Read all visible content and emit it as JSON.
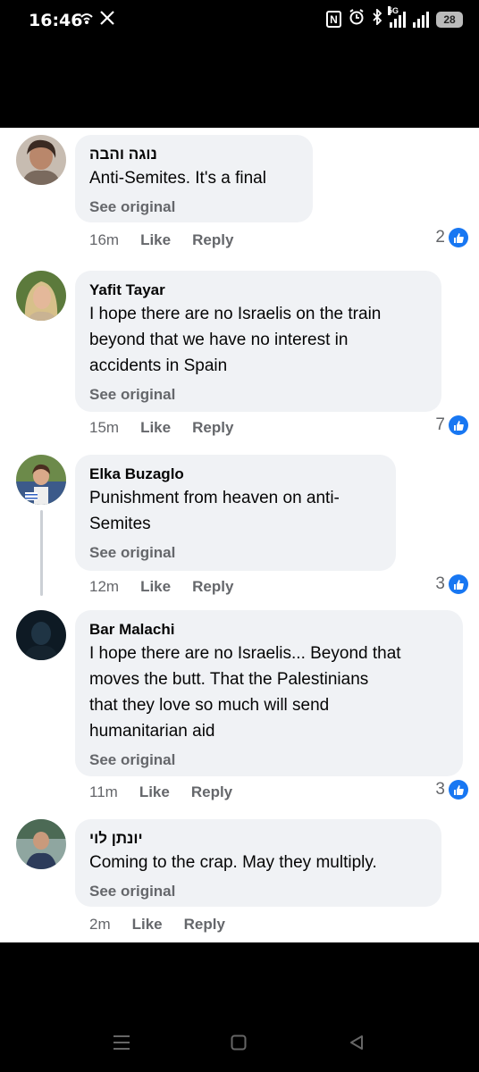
{
  "status_bar": {
    "time": "16:46",
    "left_icons": [
      "wifi-calling-icon",
      "x-logo-icon"
    ],
    "right_icons": [
      "nfc-icon",
      "alarm-icon",
      "bluetooth-icon",
      "signal-5g-icon",
      "signal-icon"
    ],
    "network_label": "5G",
    "battery": "28"
  },
  "comments": [
    {
      "author": "נוגה והבה",
      "text_lines": [
        "Anti-Semites. It's a final"
      ],
      "see_original": "See original",
      "time": "16m",
      "like": "Like",
      "reply": "Reply",
      "reactions": "2"
    },
    {
      "author": "Yafit Tayar",
      "text_lines": [
        "I hope there are no Israelis on the train",
        "beyond that we have no interest in",
        "accidents in Spain"
      ],
      "see_original": "See original",
      "time": "15m",
      "like": "Like",
      "reply": "Reply",
      "reactions": "7"
    },
    {
      "author": "Elka Buzaglo",
      "text_lines": [
        "Punishment from heaven on anti-",
        "Semites"
      ],
      "see_original": "See original",
      "time": "12m",
      "like": "Like",
      "reply": "Reply",
      "reactions": "3"
    },
    {
      "author": "Bar Malachi",
      "text_lines": [
        "I hope there are no Israelis... Beyond that",
        "moves the butt. That the Palestinians",
        "that they love so much will send",
        "humanitarian aid"
      ],
      "see_original": "See original",
      "time": "11m",
      "like": "Like",
      "reply": "Reply",
      "reactions": "3"
    },
    {
      "author": "יונתן לוי",
      "text_lines": [
        "Coming to the crap. May they multiply."
      ],
      "see_original": "See original",
      "time": "2m",
      "like": "Like",
      "reply": "Reply",
      "reactions": ""
    }
  ],
  "nav_bar": [
    "recent-apps-icon",
    "home-icon",
    "back-icon"
  ],
  "colors": {
    "like_blue": "#1877f2",
    "bubble_bg": "#f0f2f5",
    "meta_gray": "#65676b"
  }
}
